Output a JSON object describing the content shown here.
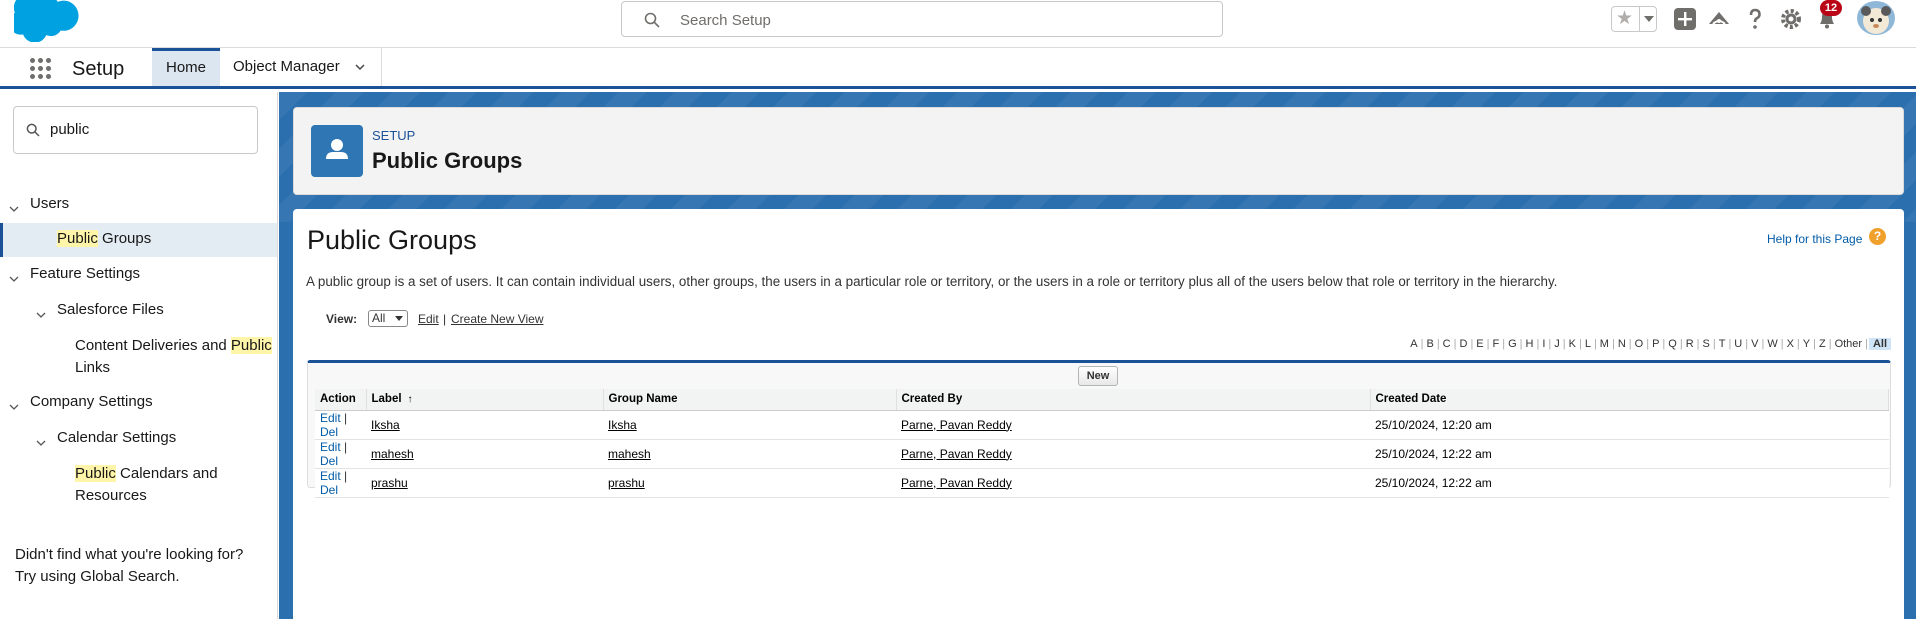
{
  "header": {
    "search_placeholder": "Search Setup",
    "notification_count": "12"
  },
  "nav": {
    "app_name": "Setup",
    "tabs": [
      {
        "label": "Home"
      },
      {
        "label": "Object Manager"
      }
    ]
  },
  "sidebar": {
    "quick_find_value": "public",
    "tree": {
      "users": "Users",
      "public_groups_hl": "Public",
      "public_groups_rest": " Groups",
      "feature_settings": "Feature Settings",
      "salesforce_files": "Salesforce Files",
      "content_deliveries_pre": "Content Deliveries and ",
      "content_deliveries_hl": "Public",
      "content_deliveries_line2": "Links",
      "company_settings": "Company Settings",
      "calendar_settings": "Calendar Settings",
      "public_calendars_hl": "Public",
      "public_calendars_rest": " Calendars and",
      "public_calendars_line2": "Resources"
    },
    "help_line1": "Didn't find what you're looking for?",
    "help_line2": "Try using Global Search."
  },
  "page_header": {
    "breadcrumb": "SETUP",
    "title": "Public Groups"
  },
  "content": {
    "heading": "Public Groups",
    "help_link": "Help for this Page",
    "description": "A public group is a set of users. It can contain individual users, other groups, the users in a particular role or territory, or the users in a role or territory plus all of the users below that role or territory in the hierarchy.",
    "view_label": "View:",
    "view_value": "All",
    "view_edit": "Edit",
    "view_sep": "|",
    "view_create": "Create New View",
    "alphabet": [
      "A",
      "B",
      "C",
      "D",
      "E",
      "F",
      "G",
      "H",
      "I",
      "J",
      "K",
      "L",
      "M",
      "N",
      "O",
      "P",
      "Q",
      "R",
      "S",
      "T",
      "U",
      "V",
      "W",
      "X",
      "Y",
      "Z",
      "Other",
      "All"
    ],
    "new_button": "New",
    "table": {
      "headers": [
        "Action",
        "Label",
        "Group Name",
        "Created By",
        "Created Date"
      ],
      "sort_indicator": "↑",
      "rows": [
        {
          "edit": "Edit",
          "sep": "|",
          "del": "Del",
          "label": "Iksha",
          "group_name": "Iksha",
          "created_by": "Parne, Pavan Reddy",
          "created_date": "25/10/2024, 12:20 am"
        },
        {
          "edit": "Edit",
          "sep": "|",
          "del": "Del",
          "label": "mahesh",
          "group_name": "mahesh",
          "created_by": "Parne, Pavan Reddy",
          "created_date": "25/10/2024, 12:22 am"
        },
        {
          "edit": "Edit",
          "sep": "|",
          "del": "Del",
          "label": "prashu",
          "group_name": "prashu",
          "created_by": "Parne, Pavan Reddy",
          "created_date": "25/10/2024, 12:22 am"
        }
      ]
    }
  },
  "colors": {
    "brand_blue": "#1b5297",
    "header_icon_bg": "#2f77b4",
    "link_blue": "#015ba7",
    "badge_red": "#ba0517",
    "highlight": "#fff5a8"
  }
}
